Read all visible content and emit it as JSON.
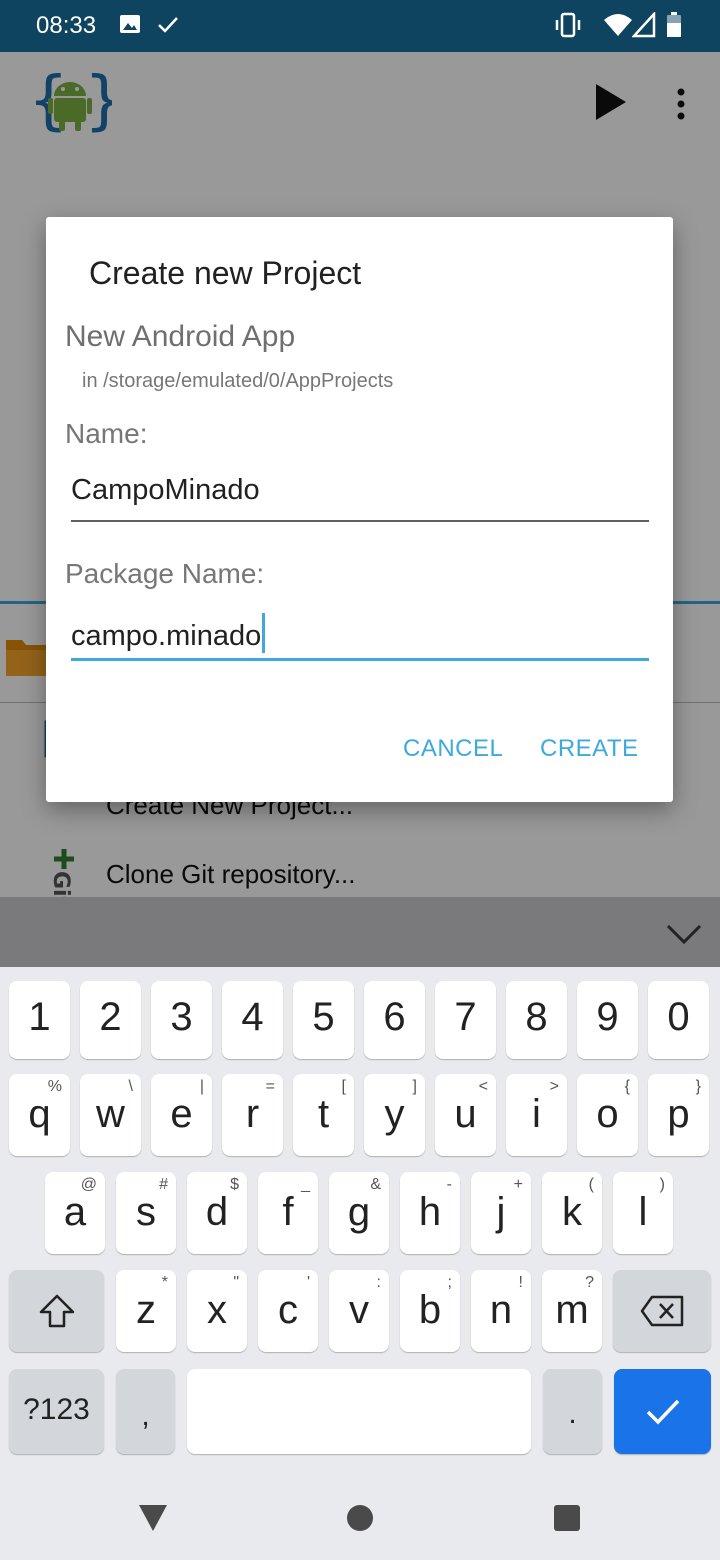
{
  "status_bar": {
    "time": "08:33",
    "icons": [
      "image-icon",
      "check-icon",
      "vibrate-icon",
      "wifi-icon",
      "signal-icon",
      "battery-icon"
    ]
  },
  "app": {
    "icons": [
      "android-logo-icon",
      "play-icon",
      "more-vert-icon",
      "folder-icon"
    ],
    "menu_items": [
      {
        "label": "Create New Project...",
        "icon": "new-project-icon"
      },
      {
        "label": "Clone Git repository...",
        "icon": "git-icon"
      }
    ]
  },
  "dialog": {
    "title": "Create new Project",
    "subtitle": "New Android App",
    "path": "in /storage/emulated/0/AppProjects",
    "name_label": "Name:",
    "name_value": "CampoMinado",
    "package_label": "Package Name:",
    "package_value": "campo.minado",
    "cancel_label": "CANCEL",
    "create_label": "CREATE"
  },
  "keyboard": {
    "numbers": [
      "1",
      "2",
      "3",
      "4",
      "5",
      "6",
      "7",
      "8",
      "9",
      "0"
    ],
    "row1": [
      {
        "k": "q",
        "s": "%"
      },
      {
        "k": "w",
        "s": "\\"
      },
      {
        "k": "e",
        "s": "|"
      },
      {
        "k": "r",
        "s": "="
      },
      {
        "k": "t",
        "s": "["
      },
      {
        "k": "y",
        "s": "]"
      },
      {
        "k": "u",
        "s": "<"
      },
      {
        "k": "i",
        "s": ">"
      },
      {
        "k": "o",
        "s": "{"
      },
      {
        "k": "p",
        "s": "}"
      }
    ],
    "row2": [
      {
        "k": "a",
        "s": "@"
      },
      {
        "k": "s",
        "s": "#"
      },
      {
        "k": "d",
        "s": "$"
      },
      {
        "k": "f",
        "s": "_"
      },
      {
        "k": "g",
        "s": "&"
      },
      {
        "k": "h",
        "s": "-"
      },
      {
        "k": "j",
        "s": "+"
      },
      {
        "k": "k",
        "s": "("
      },
      {
        "k": "l",
        "s": ")"
      }
    ],
    "row3": [
      {
        "k": "z",
        "s": "*"
      },
      {
        "k": "x",
        "s": "\""
      },
      {
        "k": "c",
        "s": "'"
      },
      {
        "k": "v",
        "s": ":"
      },
      {
        "k": "b",
        "s": ";"
      },
      {
        "k": "n",
        "s": "!"
      },
      {
        "k": "m",
        "s": "?"
      }
    ],
    "symbols_label": "?123",
    "comma_label": ",",
    "period_label": ".",
    "special_icons": [
      "shift-icon",
      "backspace-icon",
      "enter-check-icon",
      "keyboard-collapse-icon"
    ]
  },
  "nav": {
    "icons": [
      "back-icon",
      "home-icon",
      "recents-icon"
    ]
  },
  "colors": {
    "status_bar": "#0e4460",
    "accent": "#3da9de",
    "enter_key": "#1a73e8"
  }
}
